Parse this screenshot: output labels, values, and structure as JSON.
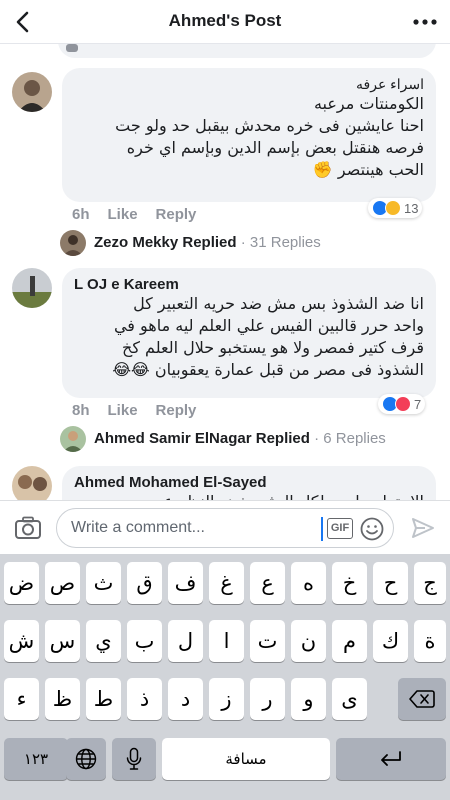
{
  "header": {
    "title": "Ahmed's Post",
    "back_icon": "chevron-left-icon",
    "more_icon": "ellipsis-icon"
  },
  "comments": [
    {
      "author": "اسراء عرفه",
      "lines": [
        "الكومنتات مرعبه",
        "احنا عايشين فى خره محدش بيقبل حد ولو جت",
        "فرصه هنقتل بعض بإسم الدين وبإسم اي خره",
        "الحب هينتصر ✊"
      ],
      "time": "6h",
      "like": "Like",
      "reply": "Reply",
      "reactions": {
        "types": [
          "like",
          "haha"
        ],
        "count": "13"
      },
      "replied": {
        "name": "Zezo Mekky",
        "action": "Replied",
        "count": "· 31 Replies"
      }
    },
    {
      "author": "L OJ e Kareem",
      "lines": [
        "انا ضد الشذوذ بس مش ضد حريه التعبير كل",
        "واحد حرر قالبين الفيس علي العلم ليه ماهو في",
        "قرف كتير فمصر ولا هو يستخبو حلال العلم كخ",
        "الشذوذ فى مصر من قبل عمارة يعقوبيان 😂😂"
      ],
      "time": "8h",
      "like": "Like",
      "reply": "Reply",
      "reactions": {
        "types": [
          "like",
          "love"
        ],
        "count": "7"
      },
      "replied": {
        "name": "Ahmed Samir ElNagar",
        "action": "Replied",
        "count": "· 6 Replies"
      }
    },
    {
      "author": "Ahmed Mohamed El-Sayed",
      "lines": [
        "الاحترام واجب لكل البشر بغض النظر عن"
      ]
    }
  ],
  "composer": {
    "placeholder": "Write a comment...",
    "gif_label": "GIF",
    "camera_icon": "camera-icon",
    "emoji_icon": "smiley-icon",
    "send_icon": "send-icon"
  },
  "keyboard": {
    "row1": [
      "ض",
      "ص",
      "ث",
      "ق",
      "ف",
      "غ",
      "ع",
      "ه",
      "خ",
      "ح",
      "ج"
    ],
    "row2": [
      "ش",
      "س",
      "ي",
      "ب",
      "ل",
      "ا",
      "ت",
      "ن",
      "م",
      "ك",
      "ة"
    ],
    "row3": [
      "ء",
      "ظ",
      "ط",
      "ذ",
      "د",
      "ز",
      "ر",
      "و",
      "ى"
    ],
    "numbers_label": "١٢٣",
    "space_label": "مسافة",
    "globe_icon": "globe-icon",
    "mic_icon": "microphone-icon",
    "delete_icon": "backspace-icon",
    "return_icon": "return-icon"
  }
}
